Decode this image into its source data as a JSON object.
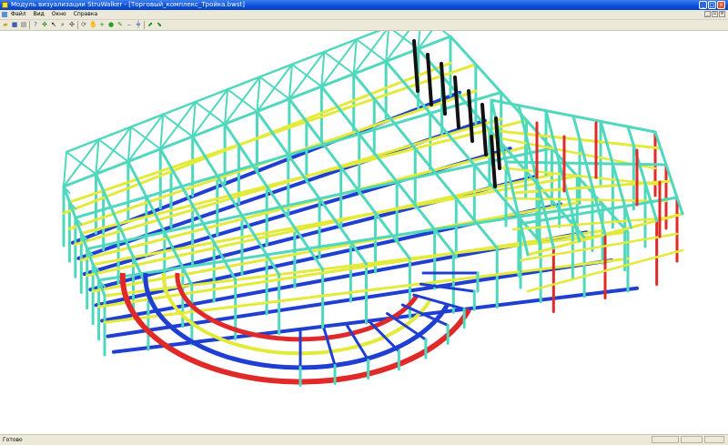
{
  "window": {
    "title": "Модуль визуализации StruWalker - [Торговый_комплекс_Тройка.bwst]",
    "buttons": [
      "minimize",
      "maximize",
      "close"
    ]
  },
  "menu": {
    "items": [
      "Файл",
      "Вид",
      "Окно",
      "Справка"
    ]
  },
  "toolbar": {
    "icons": [
      "open-icon",
      "save-icon",
      "print-icon",
      "help-icon",
      "zoom-extents-icon",
      "select-icon",
      "zoom-icon",
      "pan-icon",
      "rotate-icon",
      "hand-icon",
      "add-node-icon",
      "render-icon",
      "color-icon",
      "line-style-icon",
      "sections-icon",
      "view-icon"
    ]
  },
  "model": {
    "colors": {
      "column": "#4fd8bd",
      "column_stroke": "#2a8f7e",
      "beam_yellow": "#e3ea3a",
      "beam_blue": "#1f3fd2",
      "beam_red": "#e02a2a",
      "beam_black": "#111111"
    },
    "description_note": "3D steel frame structure"
  },
  "status": {
    "text": "Готово"
  }
}
